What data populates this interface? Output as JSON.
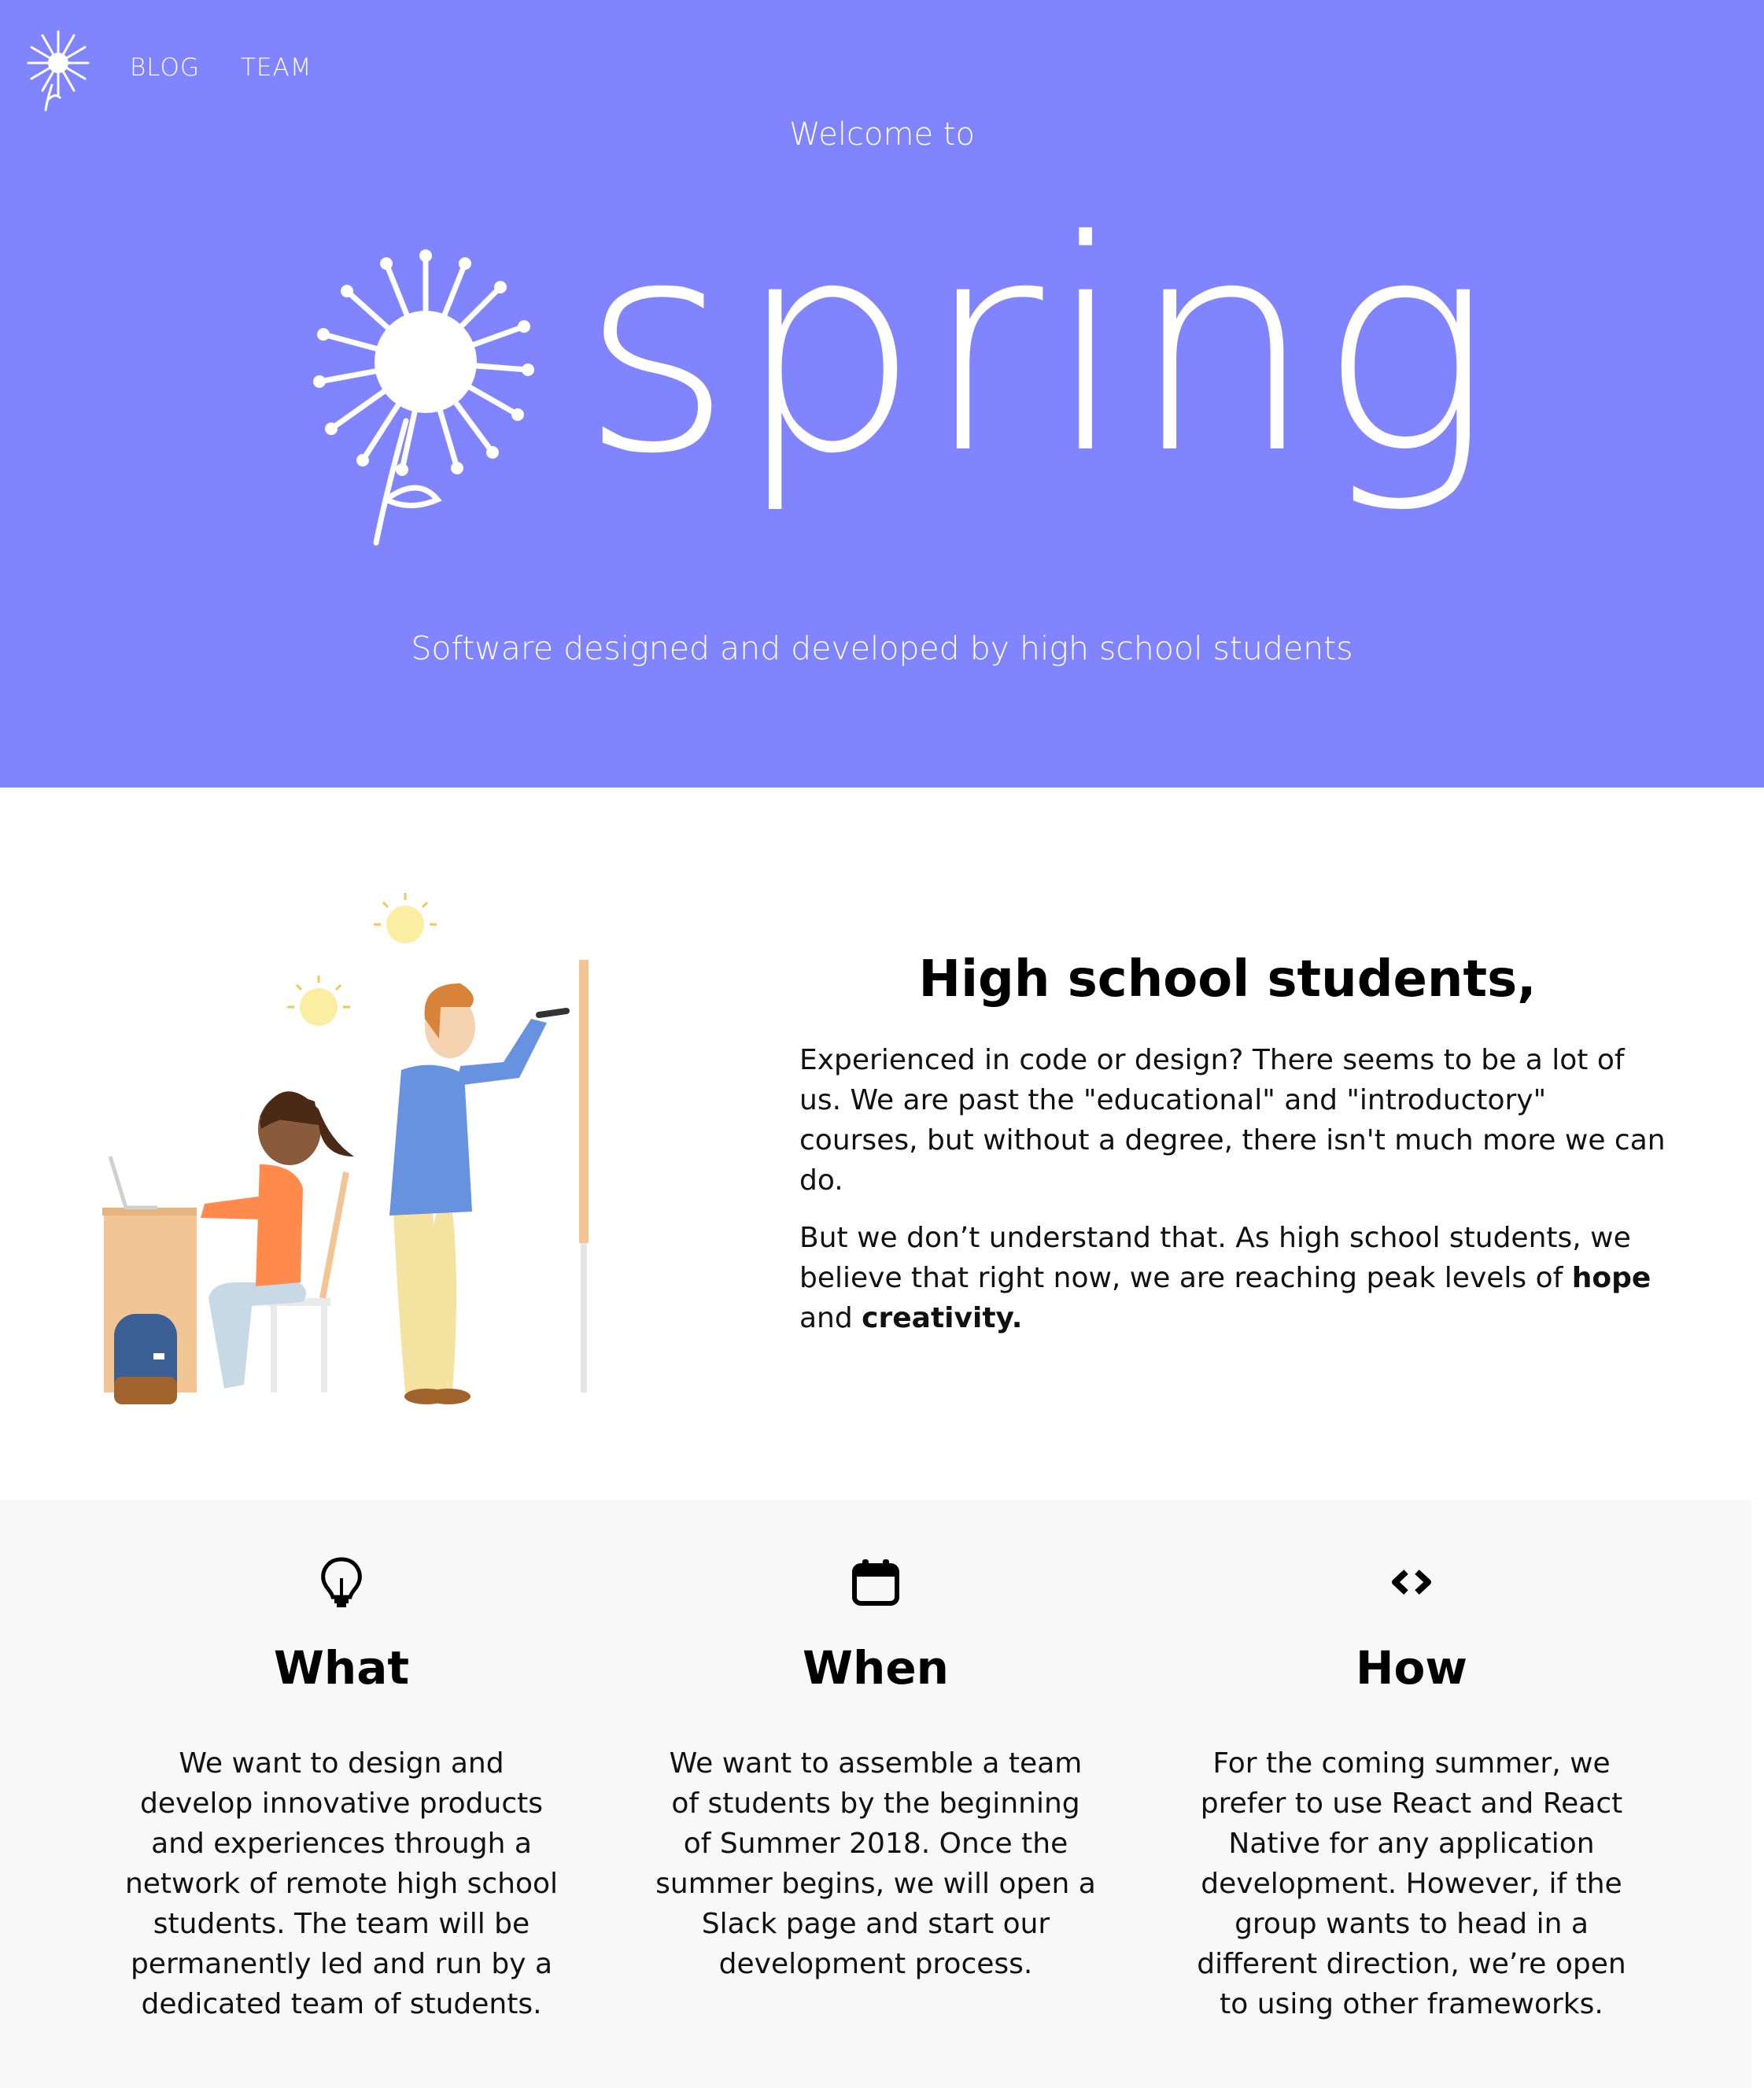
{
  "nav": {
    "links": [
      "BLOG",
      "TEAM"
    ]
  },
  "hero": {
    "welcome": "Welcome to",
    "wordmark": "spring",
    "tagline": "Software designed and developed by high school students"
  },
  "intro": {
    "heading": "High school students,",
    "para1": "Experienced in code or design? There seems to be a lot of us. We are past the \"educational\" and \"introductory\" courses, but without a degree, there isn't much more we can do.",
    "para2_before": "But we don’t understand that. As high school students, we believe that right now, we are reaching peak levels of ",
    "para2_bold1": "hope",
    "para2_between": " and ",
    "para2_bold2": "creativity."
  },
  "features": [
    {
      "icon": "lightbulb-icon",
      "title": "What",
      "text": "We want to design and develop innovative products and experiences through a network of remote high school students. The team will be permanently led and run by a dedicated team of students."
    },
    {
      "icon": "calendar-icon",
      "title": "When",
      "text": "We want to assemble a team of students by the beginning of Summer 2018. Once the summer begins, we will open a Slack page and start our development process."
    },
    {
      "icon": "code-icon",
      "title": "How",
      "text": "For the coming summer, we prefer to use React and React Native for any application development. However, if the group wants to head in a different direction, we’re open to using other frameworks."
    }
  ],
  "colors": {
    "hero_bg": "#8084ff",
    "features_bg": "#f8f8f8"
  }
}
